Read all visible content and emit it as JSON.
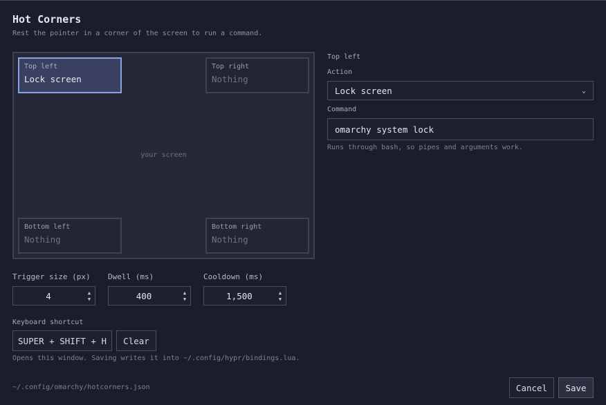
{
  "header": {
    "title": "Hot Corners",
    "subtitle": "Rest the pointer in a corner of the screen to run a command."
  },
  "screen": {
    "label": "your screen",
    "corners": [
      {
        "id": "top-left",
        "name": "Top left",
        "value": "Lock screen",
        "selected": true
      },
      {
        "id": "top-right",
        "name": "Top right",
        "value": "Nothing",
        "selected": false
      },
      {
        "id": "bottom-left",
        "name": "Bottom left",
        "value": "Nothing",
        "selected": false
      },
      {
        "id": "bottom-right",
        "name": "Bottom right",
        "value": "Nothing",
        "selected": false
      }
    ]
  },
  "panel": {
    "heading": "Top left",
    "action_label": "Action",
    "action_value": "Lock screen",
    "command_label": "Command",
    "command_value": "omarchy system lock",
    "command_hint": "Runs through bash, so pipes and arguments work."
  },
  "settings": {
    "trigger_label": "Trigger size (px)",
    "trigger_value": "4",
    "dwell_label": "Dwell (ms)",
    "dwell_value": "400",
    "cooldown_label": "Cooldown (ms)",
    "cooldown_value": "1,500"
  },
  "shortcut": {
    "label": "Keyboard shortcut",
    "keys": "SUPER + SHIFT + H",
    "clear_label": "Clear",
    "hint": "Opens this window. Saving writes it into ~/.config/hypr/bindings.lua."
  },
  "footer": {
    "path": "~/.config/omarchy/hotcorners.json",
    "cancel_label": "Cancel",
    "save_label": "Save"
  },
  "colors": {
    "background": "#1c1d2a",
    "selected_border": "#86a4e6",
    "selected_fill": "#3a4160"
  },
  "icons": {
    "dropdown": "chevron-down-icon",
    "spin_up": "caret-up-icon",
    "spin_down": "caret-down-icon"
  }
}
